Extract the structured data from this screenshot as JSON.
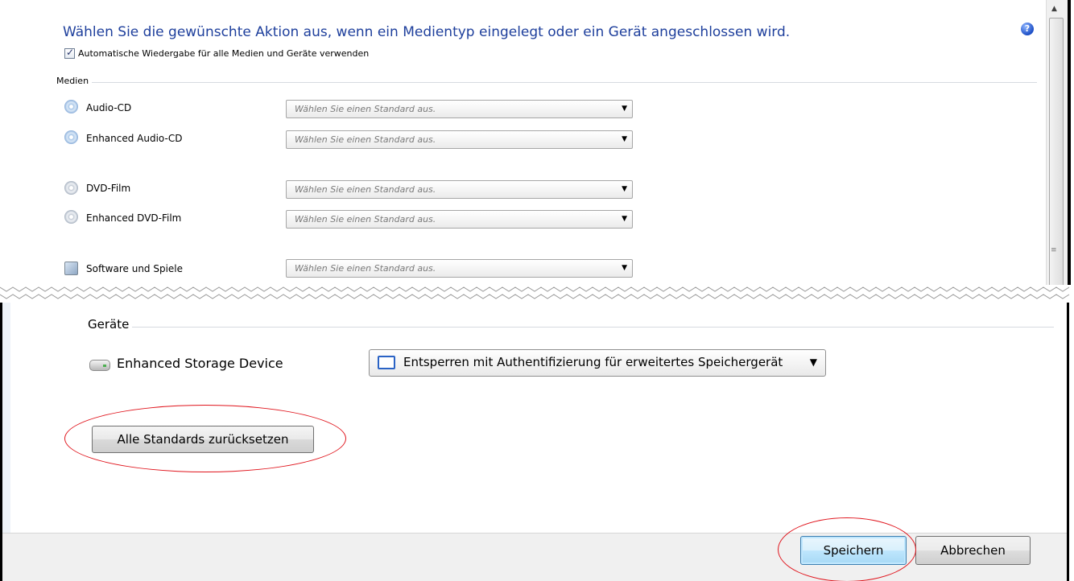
{
  "header": {
    "title": "Wählen Sie die gewünschte Aktion aus, wenn ein Medientyp eingelegt oder ein Gerät angeschlossen wird.",
    "help_icon": "?",
    "autoplay_checkbox": {
      "label": "Automatische Wiedergabe für alle Medien und Geräte verwenden",
      "checked": true
    }
  },
  "media": {
    "group_label": "Medien",
    "items": [
      {
        "label": "Audio-CD",
        "icon": "audio-cd-icon",
        "value": "Wählen Sie einen Standard aus."
      },
      {
        "label": "Enhanced Audio-CD",
        "icon": "audio-cd-icon",
        "value": "Wählen Sie einen Standard aus."
      },
      {
        "label": "DVD-Film",
        "icon": "dvd-icon",
        "value": "Wählen Sie einen Standard aus."
      },
      {
        "label": "Enhanced DVD-Film",
        "icon": "dvd-icon",
        "value": "Wählen Sie einen Standard aus."
      },
      {
        "label": "Software und Spiele",
        "icon": "software-icon",
        "value": "Wählen Sie einen Standard aus."
      }
    ]
  },
  "devices": {
    "group_label": "Geräte",
    "items": [
      {
        "label": "Enhanced Storage Device",
        "icon": "storage-drive-icon",
        "value": "Entsperren mit Authentifizierung für erweitertes Speichergerät"
      }
    ]
  },
  "reset_button": {
    "label": "Alle Standards zurücksetzen"
  },
  "footer": {
    "save_label": "Speichern",
    "cancel_label": "Abbrechen"
  },
  "colors": {
    "title": "#1e3f9c",
    "highlight_ellipse": "#e0141c",
    "save_button_border": "#3c7fb1"
  }
}
